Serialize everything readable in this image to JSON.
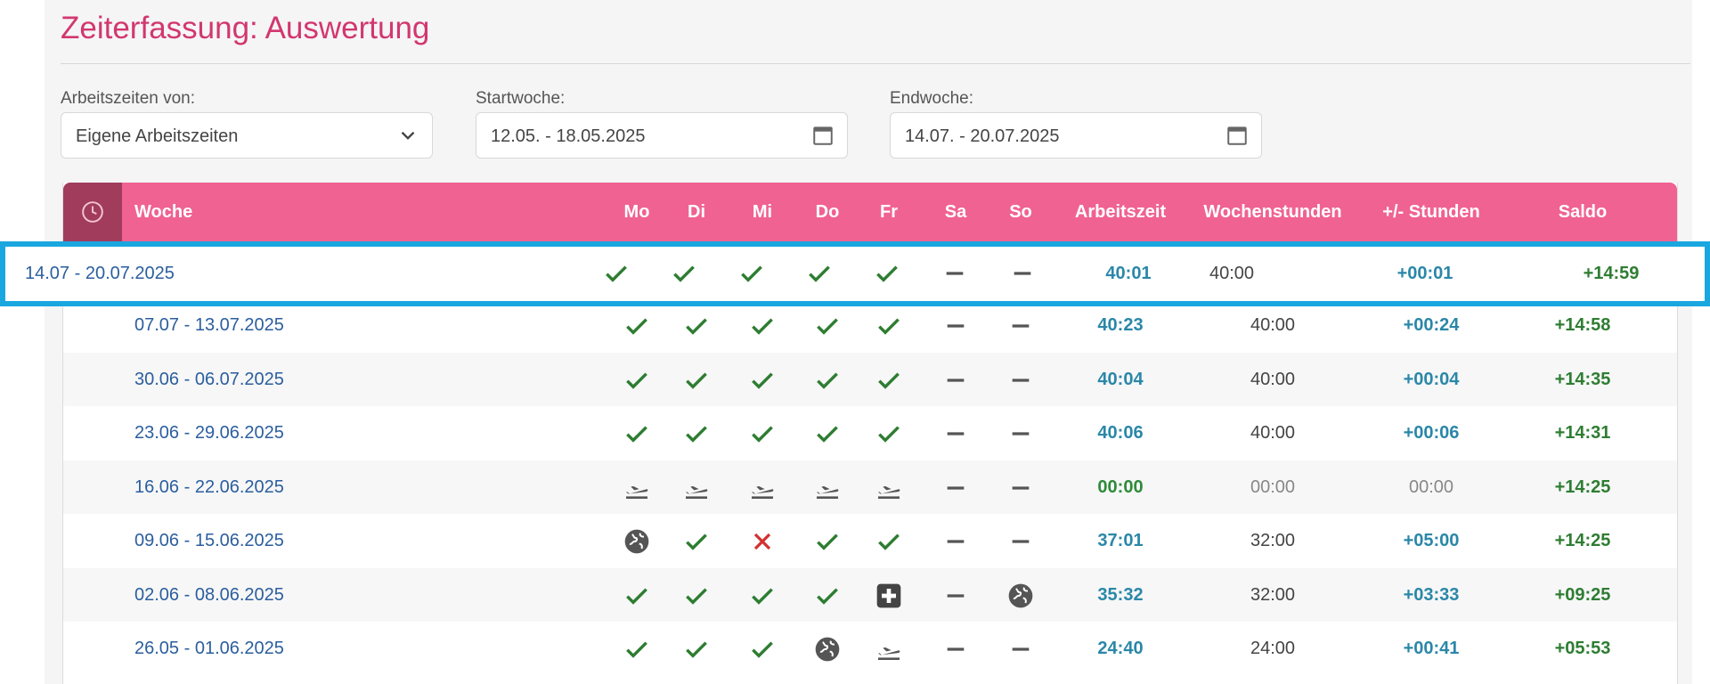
{
  "title": "Zeiterfassung: Auswertung",
  "filters": {
    "arbeitszeiten": {
      "label": "Arbeitszeiten von:",
      "value": "Eigene Arbeitszeiten"
    },
    "startwoche": {
      "label": "Startwoche:",
      "value": "12.05. - 18.05.2025"
    },
    "endwoche": {
      "label": "Endwoche:",
      "value": "14.07. - 20.07.2025"
    }
  },
  "table": {
    "headers": {
      "woche": "Woche",
      "mo": "Mo",
      "di": "Di",
      "mi": "Mi",
      "do": "Do",
      "fr": "Fr",
      "sa": "Sa",
      "so": "So",
      "arbeitszeit": "Arbeitszeit",
      "wochenstunden": "Wochenstunden",
      "plusminus": "+/- Stunden",
      "saldo": "Saldo"
    },
    "highlighted_row": {
      "week": "14.07 - 20.07.2025",
      "days": [
        "check",
        "check",
        "check",
        "check",
        "check",
        "dash",
        "dash"
      ],
      "arbeitszeit": "40:01",
      "wochenstunden": "40:00",
      "plusminus": "+00:01",
      "saldo": "+14:59"
    },
    "rows": [
      {
        "week": "07.07 - 13.07.2025",
        "days": [
          "check",
          "check",
          "check",
          "check",
          "check",
          "dash",
          "dash"
        ],
        "arbeitszeit": "40:23",
        "wochenstunden": "40:00",
        "plusminus": "+00:24",
        "saldo": "+14:58"
      },
      {
        "week": "30.06 - 06.07.2025",
        "days": [
          "check",
          "check",
          "check",
          "check",
          "check",
          "dash",
          "dash"
        ],
        "arbeitszeit": "40:04",
        "wochenstunden": "40:00",
        "plusminus": "+00:04",
        "saldo": "+14:35"
      },
      {
        "week": "23.06 - 29.06.2025",
        "days": [
          "check",
          "check",
          "check",
          "check",
          "check",
          "dash",
          "dash"
        ],
        "arbeitszeit": "40:06",
        "wochenstunden": "40:00",
        "plusminus": "+00:06",
        "saldo": "+14:31"
      },
      {
        "week": "16.06 - 22.06.2025",
        "days": [
          "plane",
          "plane",
          "plane",
          "plane",
          "plane",
          "dash",
          "dash"
        ],
        "arbeitszeit": "00:00",
        "wochenstunden": "00:00",
        "plusminus": "00:00",
        "saldo": "+14:25"
      },
      {
        "week": "09.06 - 15.06.2025",
        "days": [
          "globe",
          "check",
          "cross",
          "check",
          "check",
          "dash",
          "dash"
        ],
        "arbeitszeit": "37:01",
        "wochenstunden": "32:00",
        "plusminus": "+05:00",
        "saldo": "+14:25"
      },
      {
        "week": "02.06 - 08.06.2025",
        "days": [
          "check",
          "check",
          "check",
          "check",
          "medical",
          "dash",
          "globe"
        ],
        "arbeitszeit": "35:32",
        "wochenstunden": "32:00",
        "plusminus": "+03:33",
        "saldo": "+09:25"
      },
      {
        "week": "26.05 - 01.06.2025",
        "days": [
          "check",
          "check",
          "check",
          "globe",
          "plane",
          "dash",
          "dash"
        ],
        "arbeitszeit": "24:40",
        "wochenstunden": "24:00",
        "plusminus": "+00:41",
        "saldo": "+05:53"
      }
    ]
  },
  "colors": {
    "accent": "#f06292",
    "title": "#d2376f",
    "highlight_border": "#1aa7e0",
    "check": "#2e7d32",
    "cross": "#d32f2f"
  }
}
